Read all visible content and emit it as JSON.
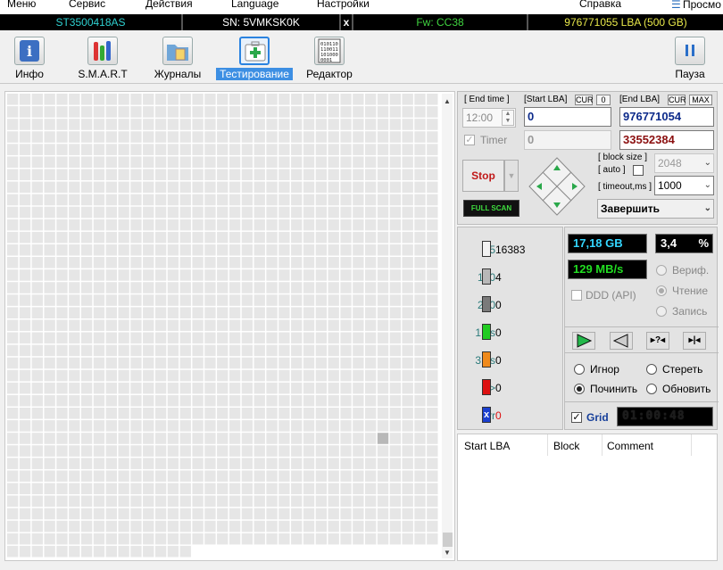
{
  "menu": {
    "items": [
      "Меню",
      "Сервис",
      "Действия",
      "Language",
      "Настройки",
      "Справка"
    ],
    "view_button": "Просмо"
  },
  "status_bar": {
    "model": "ST3500418AS",
    "serial": "SN: 5VMKSK0K",
    "close": "x",
    "firmware": "Fw: CC38",
    "capacity": "976771055 LBA (500 GB)",
    "colors": {
      "model": "#2fd0d0",
      "serial": "#ffffff",
      "firmware": "#3fd23f",
      "capacity": "#e8e84a"
    }
  },
  "toolbar": {
    "info": "Инфо",
    "smart": "S.M.A.R.T",
    "logs": "Журналы",
    "testing": "Тестирование",
    "editor": "Редактор",
    "pause": "Пауза",
    "editor_icon_text": [
      "010110",
      "110011",
      "101000",
      "0001"
    ]
  },
  "params": {
    "end_time_label": "[ End time ]",
    "end_time_value": "12:00",
    "timer_label": "Timer",
    "start_lba_label": "[Start LBA]",
    "cur_tag": "CUR",
    "zero_tag": "0",
    "start_lba_value": "0",
    "start_lba_second": "0",
    "end_lba_label": "[End LBA]",
    "end_cur_tag": "CUR",
    "max_tag": "MAX",
    "end_lba_value": "976771054",
    "end_lba_second": "33552384",
    "stop_label": "Stop",
    "full_scan_label": "FULL SCAN",
    "block_size_label": "[ block size ]",
    "auto_label": "[ auto ]",
    "block_size_value": "2048",
    "timeout_label": "[ timeout,ms ]",
    "timeout_value": "1000",
    "finish_action": "Завершить"
  },
  "legend": [
    {
      "label": "25",
      "count": "16383",
      "color": "#f2f2f2"
    },
    {
      "label": "100",
      "count": "4",
      "color": "#b8b8b8"
    },
    {
      "label": "250",
      "count": "0",
      "color": "#7a7a7a"
    },
    {
      "label": "1,0s",
      "count": "0",
      "color": "#22cc22"
    },
    {
      "label": "3,0s",
      "count": "0",
      "color": "#f08a1c"
    },
    {
      "label": ">",
      "count": "0",
      "color": "#dd1111"
    },
    {
      "label": "Err",
      "count": "0",
      "color": "#1a3fd0",
      "glyph": "x"
    }
  ],
  "stats": {
    "position": "17,18 GB",
    "percent": "3,4",
    "percent_unit": "%",
    "speed": "129 MB/s",
    "verify": "Вериф.",
    "read": "Чтение",
    "write": "Запись",
    "ddd": "DDD (API)",
    "ignore": "Игнор",
    "erase": "Стереть",
    "repair": "Починить",
    "refresh": "Обновить",
    "grid_label": "Grid",
    "timer_value": "01:00:48",
    "colors": {
      "position": "#33d6ff",
      "percent": "#ffffff",
      "speed": "#22dd22",
      "timer": "#1c1c1c"
    }
  },
  "table": {
    "columns": [
      "Start LBA",
      "Block",
      "Comment"
    ]
  },
  "scan_map": {
    "cols": 35,
    "rows": 37,
    "last_row_filled": 15,
    "slow_block_row": 27,
    "slow_block_col": 30
  }
}
